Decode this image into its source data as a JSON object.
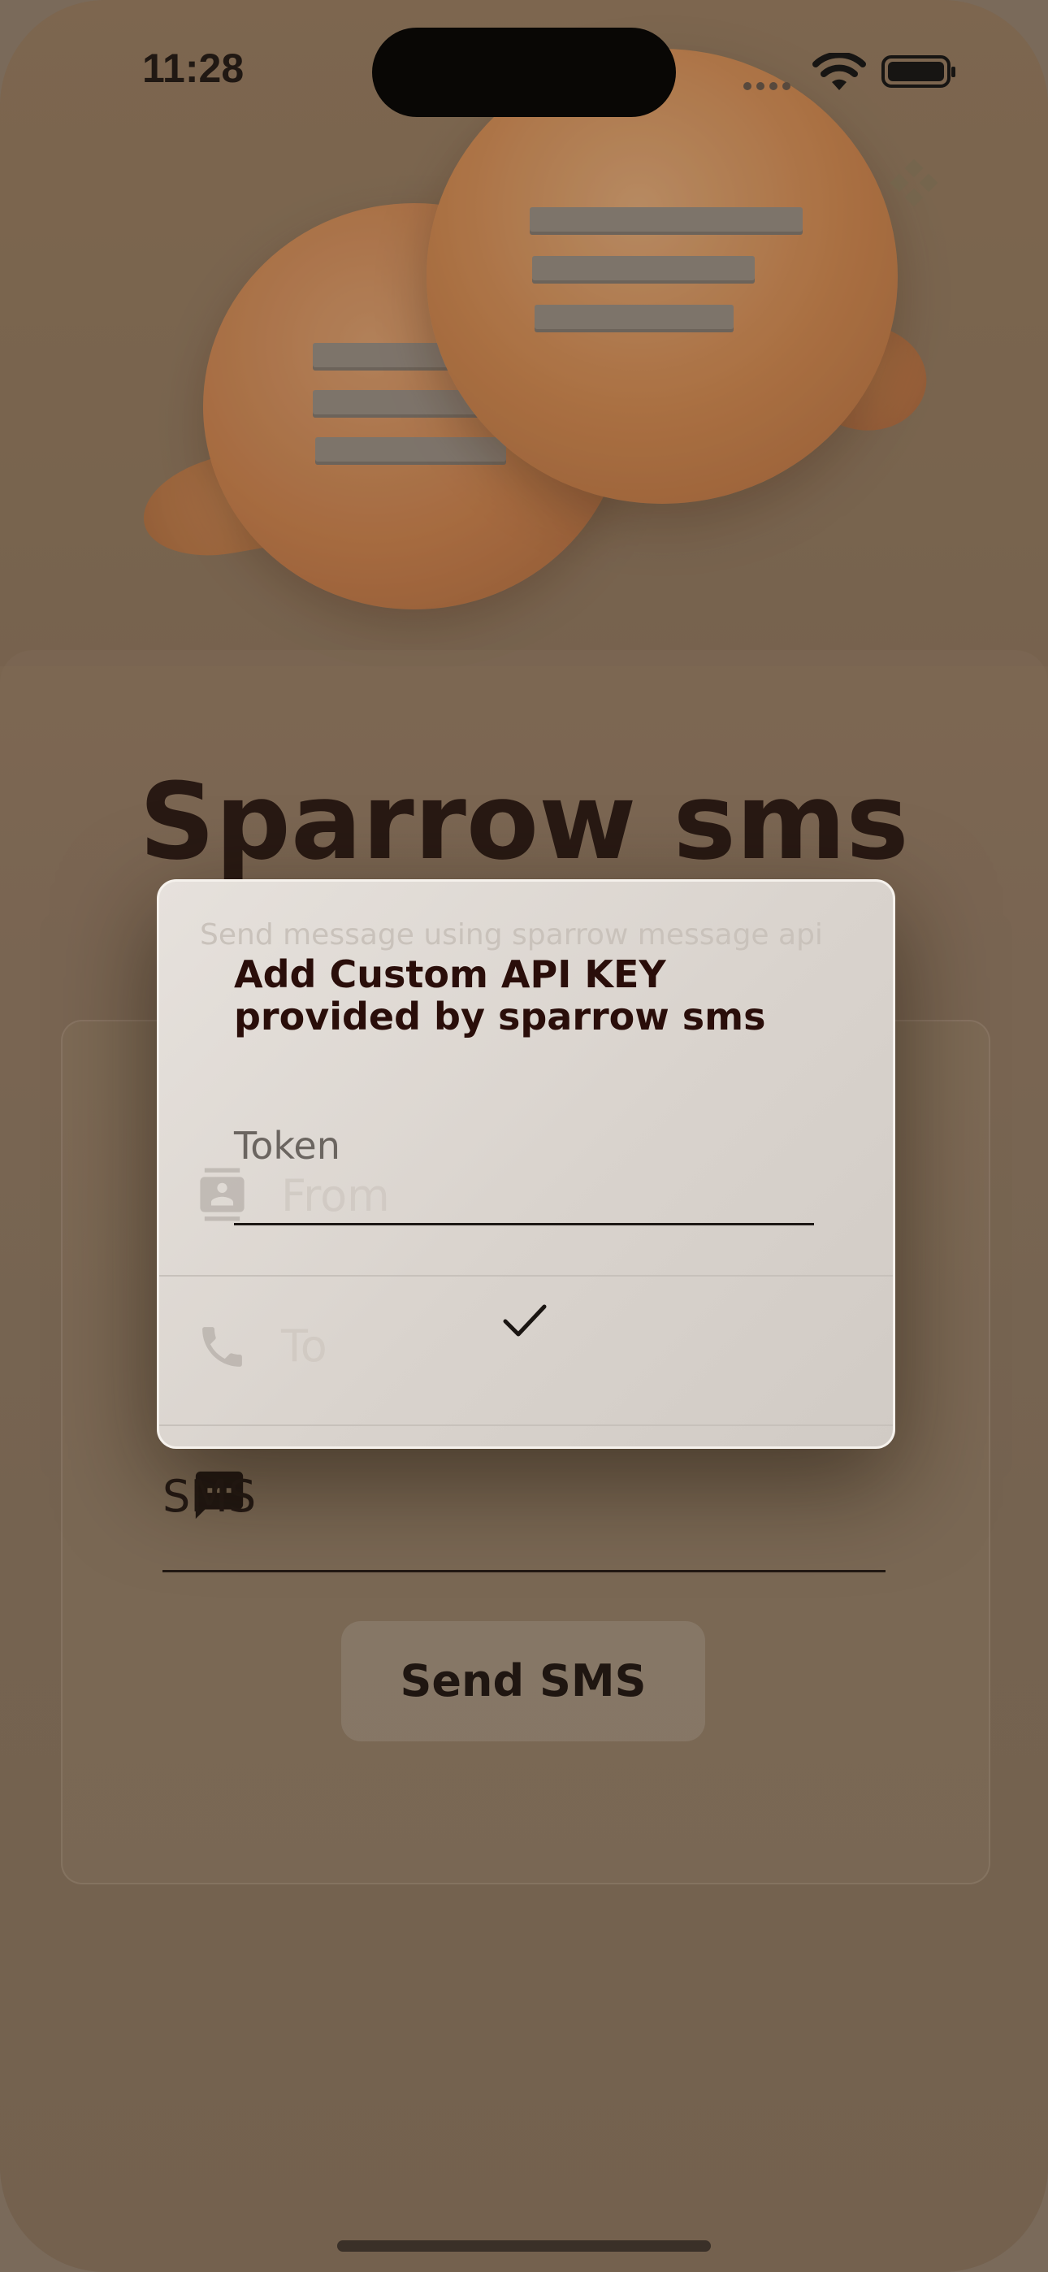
{
  "status_bar": {
    "time": "11:28"
  },
  "app": {
    "title": "Sparrow sms",
    "subtitle": "Send message using sparrow message api"
  },
  "form": {
    "from_placeholder": "From",
    "to_placeholder": "To",
    "sms_placeholder": "SMS",
    "send_label": "Send SMS"
  },
  "dialog": {
    "title": "Add Custom API KEY provided by sparrow sms",
    "token_label": "Token",
    "token_value": "",
    "confirm_icon": "check-icon"
  },
  "colors": {
    "title": "#241510",
    "dialog_title": "#2a0e0a",
    "accent_orange": "#db8442"
  }
}
